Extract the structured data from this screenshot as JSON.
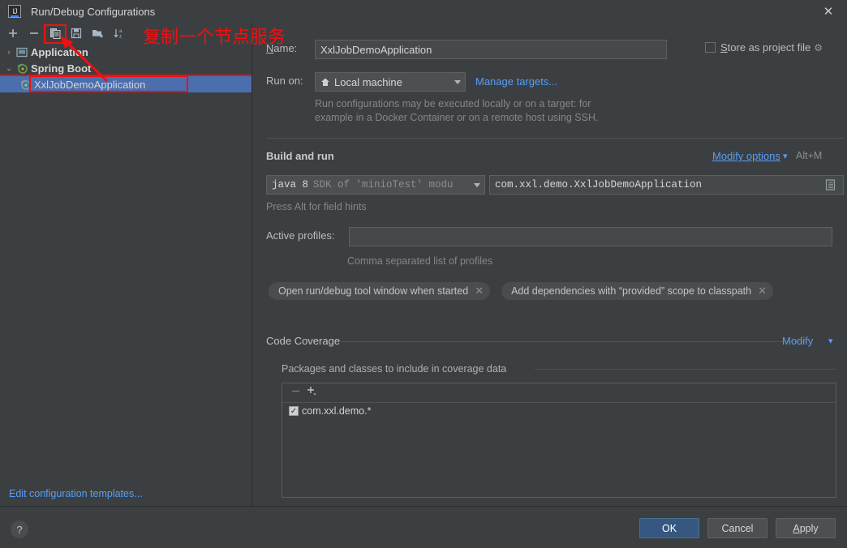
{
  "window": {
    "title": "Run/Debug Configurations",
    "app_icon": "intellij-idea-icon",
    "close_label": "✕"
  },
  "toolbar": {
    "buttons": [
      {
        "name": "add-configuration-button",
        "icon": "plus-icon",
        "tooltip": "Add New Configuration"
      },
      {
        "name": "remove-configuration-button",
        "icon": "minus-icon",
        "tooltip": "Remove Configuration"
      },
      {
        "name": "copy-configuration-button",
        "icon": "copy-icon",
        "tooltip": "Copy Configuration"
      },
      {
        "name": "save-configuration-button",
        "icon": "save-icon",
        "tooltip": "Save Configuration"
      },
      {
        "name": "new-folder-button",
        "icon": "new-folder-icon",
        "tooltip": "Create New Folder"
      },
      {
        "name": "sort-button",
        "icon": "sort-alphabetically-icon",
        "tooltip": "Sort Configurations"
      }
    ]
  },
  "tree": {
    "nodes": [
      {
        "label": "Application",
        "icon": "application-icon",
        "expanded": false,
        "arrow": "›",
        "selected": false
      },
      {
        "label": "Spring Boot",
        "icon": "spring-boot-icon",
        "expanded": true,
        "arrow": "⌄",
        "selected": false
      },
      {
        "label": "XxlJobDemoApplication",
        "icon": "spring-boot-icon",
        "selected": true
      }
    ],
    "edit_templates_label": "Edit configuration templates..."
  },
  "form": {
    "name_label": "Name:",
    "name_label_mnemonic": "N",
    "name_value": "XxlJobDemoApplication",
    "store_as_project_file_label": "Store as project file",
    "store_as_project_file_mnemonic": "S",
    "store_as_project_file_checked": false,
    "store_gear_icon": "gear-icon",
    "run_on_label": "Run on:",
    "run_on_value": "Local machine",
    "run_on_icon": "home-icon",
    "manage_targets_label": "Manage targets...",
    "run_on_hint_line1": "Run configurations may be executed locally or on a target: for",
    "run_on_hint_line2": "example in a Docker Container or on a remote host using SSH.",
    "build_and_run": {
      "section_title": "Build and run",
      "modify_options_label": "Modify options",
      "modify_options_shortcut": "Alt+M",
      "jdk_value_main": "java 8",
      "jdk_value_dim": "SDK of 'minioTest' modu",
      "main_class_value": "com.xxl.demo.XxlJobDemoApplication",
      "main_class_browse_icon": "browse-list-icon",
      "field_hint": "Press Alt for field hints"
    },
    "active_profiles_label": "Active profiles:",
    "active_profiles_value": "",
    "active_profiles_hint": "Comma separated list of profiles",
    "chips": [
      {
        "label": "Open run/debug tool window when started",
        "close": "✕"
      },
      {
        "label": "Add dependencies with “provided” scope to classpath",
        "close": "✕"
      }
    ],
    "code_coverage": {
      "section_title": "Code Coverage",
      "modify_label": "Modify",
      "group_label": "Packages and classes to include in coverage data",
      "remove_icon": "minus-icon",
      "add_icon": "plus-dropdown-icon",
      "items": [
        {
          "label": "com.xxl.demo.*",
          "checked": true,
          "check_glyph": "✓"
        }
      ]
    }
  },
  "buttons": {
    "help": "?",
    "ok": "OK",
    "cancel": "Cancel",
    "apply": "Apply",
    "apply_mnemonic": "A"
  },
  "annotation": {
    "text": "复制一个节点服务",
    "color": "#ee1111"
  },
  "colors": {
    "background": "#3c3f41",
    "selection": "#4b6eaf",
    "link": "#589df6",
    "primary_button": "#365880",
    "annotation_red": "#ee1111"
  }
}
